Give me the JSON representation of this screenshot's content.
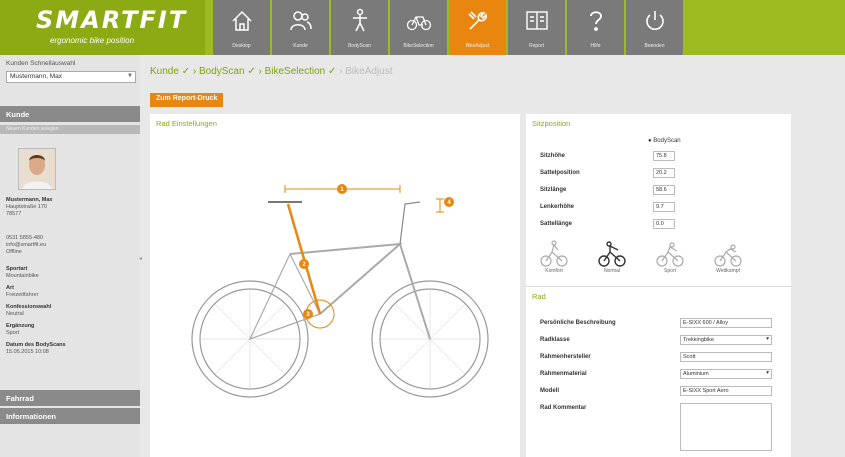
{
  "app": {
    "brand": "SMARTFIT",
    "tagline": "ergonomic bike position"
  },
  "nav": [
    {
      "label": "Desktop",
      "icon": "home-icon"
    },
    {
      "label": "Kunde",
      "icon": "users-icon"
    },
    {
      "label": "BodyScan",
      "icon": "person-icon"
    },
    {
      "label": "BikeSelection",
      "icon": "bikes-icon"
    },
    {
      "label": "BikeAdjust",
      "icon": "wrench-icon",
      "active": true
    },
    {
      "label": "Report",
      "icon": "report-icon"
    },
    {
      "label": "Hilfe",
      "icon": "help-icon"
    },
    {
      "label": "Beenden",
      "icon": "power-icon"
    }
  ],
  "sidebar": {
    "quickselect_label": "Kunden Schnellauswahl",
    "quickselect_value": "Mustermann, Max",
    "kunde_heading": "Kunde",
    "kunde_sub": "Neuen Kunden anlegen",
    "name": "Mustermann, Max",
    "street": "Hauptstraße 170",
    "city": "78577",
    "phone": "0531 5855-480",
    "email": "info@smartfit.eu",
    "email2": "Offline",
    "f1_label": "Sportart",
    "f1_value": "Mountainbike",
    "f2_label": "Art",
    "f2_value": "Freizeitfahrer",
    "f3_label": "Konfessionswahl",
    "f3_value": "Neutral",
    "f4_label": "Ergänzung",
    "f4_value": "Sport",
    "f5_label": "Datum des BodyScans",
    "f5_value": "15.05.2015 10:08",
    "fahrrad_heading": "Fahrrad",
    "info_heading": "Informationen"
  },
  "breadcrumbs": {
    "kunde": "Kunde ✓",
    "bodyscan": "› BodyScan ✓",
    "bikeselection": "› BikeSelection ✓",
    "bikeadjust": "› BikeAdjust"
  },
  "report_button": "Zum Report-Druck",
  "bike_panel": {
    "title": "Rad Einstellungen",
    "markers": [
      "1",
      "2",
      "3",
      "4"
    ]
  },
  "sitz": {
    "title": "Sitzposition",
    "radio_label": "BodyScan",
    "rows": [
      {
        "label": "Sitzhöhe",
        "value": "75.8"
      },
      {
        "label": "Sattelposition",
        "value": "20.2"
      },
      {
        "label": "Sitzlänge",
        "value": "58.6"
      },
      {
        "label": "Lenkerhöhe",
        "value": "9.7"
      },
      {
        "label": "Sattellänge",
        "value": "0.0"
      }
    ],
    "positions": [
      "Komfort",
      "Normal",
      "Sport",
      "Wettkampf"
    ]
  },
  "rad": {
    "title": "Rad",
    "rows": [
      {
        "label": "Persönliche Beschreibung",
        "value": "E-SIXX 600 / Alloy"
      },
      {
        "label": "Radklasse",
        "value": "Trekkingbike"
      },
      {
        "label": "Rahmenhersteller",
        "value": "Scott"
      },
      {
        "label": "Rahmenmaterial",
        "value": "Aluminium"
      },
      {
        "label": "Modell",
        "value": "E-SIXX Sport Aero"
      },
      {
        "label": "Rad Kommentar",
        "value": ""
      }
    ]
  },
  "colors": {
    "green": "#9bbb20",
    "orange": "#e8860f",
    "gray": "#7a7a7a"
  }
}
